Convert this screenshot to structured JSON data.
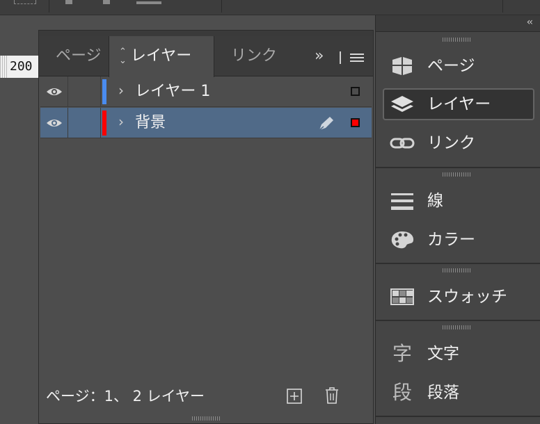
{
  "ruler": {
    "value": "200"
  },
  "layers_panel": {
    "tabs": [
      {
        "label": "ページ"
      },
      {
        "label": "レイヤー"
      },
      {
        "label": "リンク"
      }
    ],
    "more_label": "»",
    "layers": [
      {
        "name": "レイヤー 1",
        "color": "#4a8cf0",
        "selected": false,
        "square_color": "#4d4d4d"
      },
      {
        "name": "背景",
        "color": "#ff0000",
        "selected": true,
        "square_color": "#ff0000"
      }
    ],
    "footer_text": "ページ：1、 2 レイヤー"
  },
  "dock": {
    "collapse_label": "‹‹",
    "items": [
      {
        "label": "ページ",
        "icon": "pages-icon"
      },
      {
        "label": "レイヤー",
        "icon": "layers-icon",
        "active": true
      },
      {
        "label": "リンク",
        "icon": "link-icon"
      },
      {
        "label": "線",
        "icon": "stroke-icon"
      },
      {
        "label": "カラー",
        "icon": "color-palette-icon"
      },
      {
        "label": "スウォッチ",
        "icon": "swatches-icon"
      },
      {
        "label": "文字",
        "icon": "character-icon",
        "glyph": "字"
      },
      {
        "label": "段落",
        "icon": "paragraph-icon",
        "glyph": "段"
      }
    ]
  }
}
